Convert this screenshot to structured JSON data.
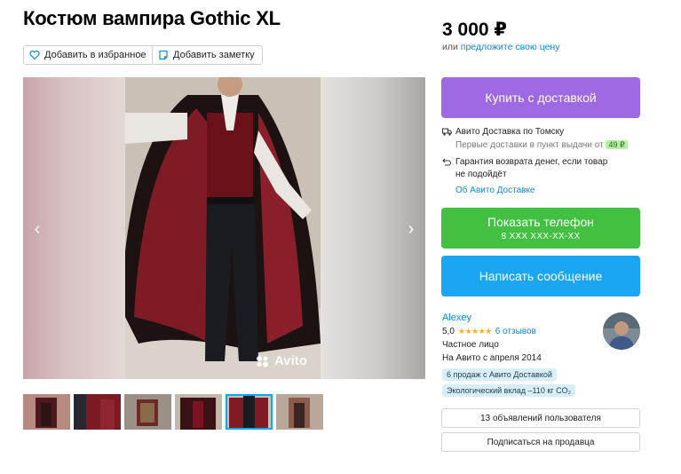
{
  "listing": {
    "title": "Костюм вампира Gothic XL",
    "favorite_label": "Добавить в избранное",
    "note_label": "Добавить заметку",
    "watermark": "Avito"
  },
  "pricing": {
    "price": "3 000 ₽",
    "prefix": "или",
    "offer_link": "предложите свою цену"
  },
  "actions": {
    "buy_label": "Купить с доставкой",
    "phone_label": "Показать телефон",
    "phone_masked": "8 XXX XXX-XX-XX",
    "message_label": "Написать сообщение"
  },
  "delivery": {
    "title": "Авито Доставка по Томску",
    "subtitle": "Первые доставки в пункт выдачи от",
    "price_badge": "49 ₽",
    "guarantee_line1": "Гарантия возврата денег, если товар",
    "guarantee_line2": "не подойдёт",
    "about_link": "Об Авито Доставке"
  },
  "seller": {
    "name": "Alexey",
    "rating": "5,0",
    "reviews": "6 отзывов",
    "type": "Частное лицо",
    "since": "На Авито с апреля 2014",
    "chip_sales": "6 продаж с Авито Доставкой",
    "chip_eco": "Экологический вклад –110 кг CO₂",
    "listings_button": "13 объявлений пользователя",
    "subscribe_button": "Подписаться на продавца"
  },
  "gallery": {
    "thumbnail_count": 6,
    "active_thumbnail": 5
  },
  "colors": {
    "buy": "#9e6ae3",
    "phone": "#43c042",
    "message": "#1aa6f2",
    "link": "#0a8ad6"
  }
}
